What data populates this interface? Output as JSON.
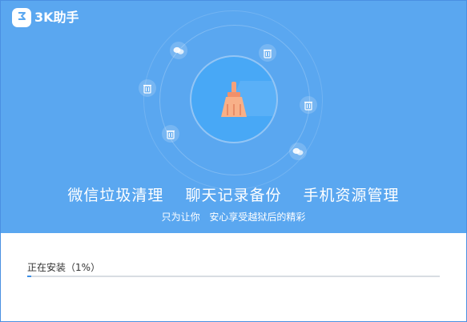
{
  "app": {
    "name": "3K助手",
    "accent_color": "#5aa7f0",
    "logo_icon": "3k-logo-icon"
  },
  "hero": {
    "center_icon": "broom-icon",
    "orbit_icons": [
      "chat-bubble-icon",
      "trash-can-icon",
      "trash-can-icon",
      "trash-can-icon",
      "trash-can-icon",
      "chat-bubble-icon"
    ],
    "features": [
      "微信垃圾清理",
      "聊天记录备份",
      "手机资源管理"
    ],
    "tagline_part1": "只为让你",
    "tagline_part2": "安心享受越狱后的精彩"
  },
  "install": {
    "status_prefix": "正在安装（",
    "percent_text": "1%",
    "status_suffix": "）",
    "progress_fraction": 0.01
  }
}
